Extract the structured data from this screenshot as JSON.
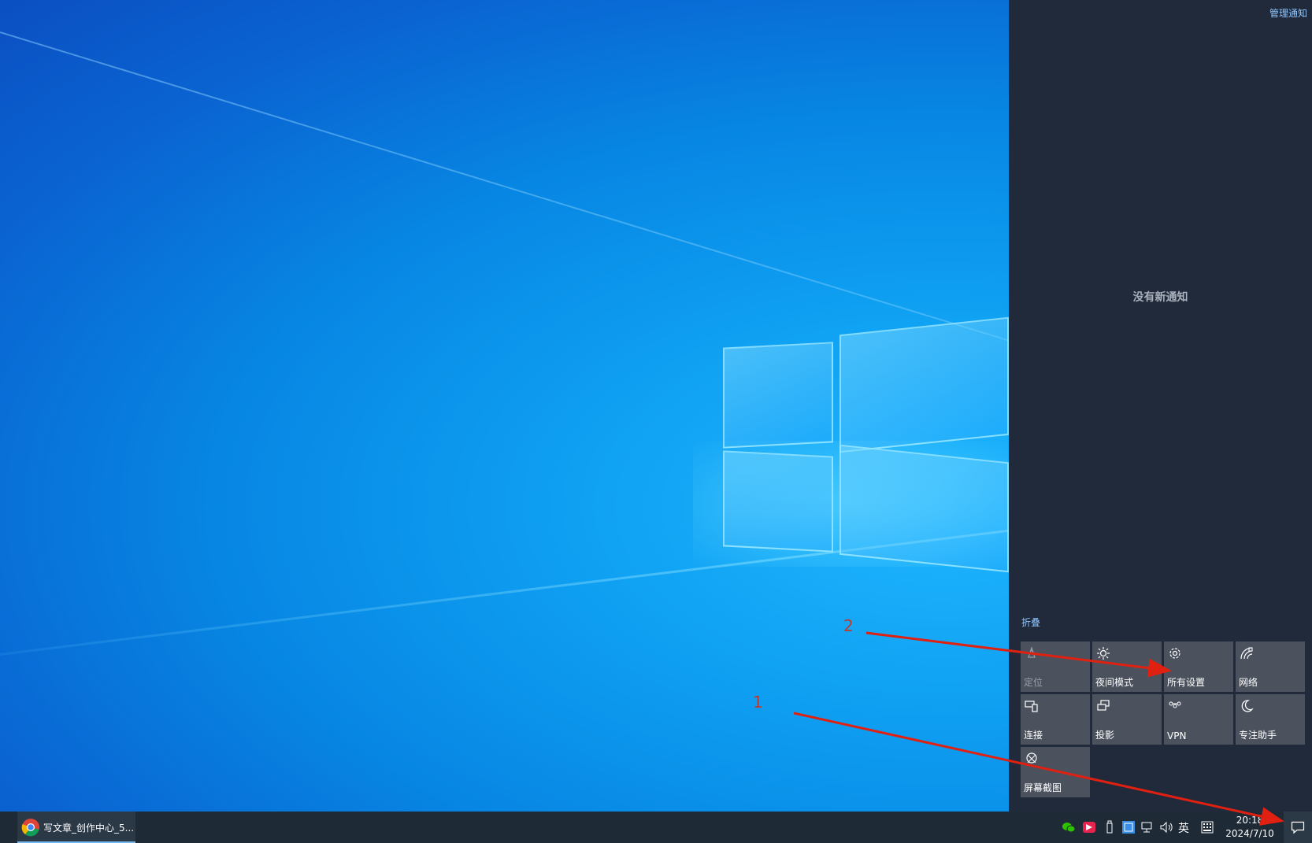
{
  "action_center": {
    "manage_label": "管理通知",
    "empty_message": "没有新通知",
    "collapse_label": "折叠",
    "quick_actions": [
      {
        "label": "定位",
        "icon": "location-icon",
        "enabled": false
      },
      {
        "label": "夜间模式",
        "icon": "night-light-icon",
        "enabled": true
      },
      {
        "label": "所有设置",
        "icon": "gear-icon",
        "enabled": true
      },
      {
        "label": "网络",
        "icon": "network-icon",
        "enabled": true
      },
      {
        "label": "连接",
        "icon": "connect-icon",
        "enabled": true
      },
      {
        "label": "投影",
        "icon": "project-icon",
        "enabled": true
      },
      {
        "label": "VPN",
        "icon": "vpn-icon",
        "enabled": true
      },
      {
        "label": "专注助手",
        "icon": "focus-assist-icon",
        "enabled": true
      },
      {
        "label": "屏幕截图",
        "icon": "screen-snip-icon",
        "enabled": true
      }
    ]
  },
  "taskbar": {
    "app_label": "写文章_创作中心_5...",
    "app_icon": "chrome-icon",
    "tray_icons": [
      "wechat-icon",
      "app-tray-icon",
      "usb-icon",
      "app-tray-icon-2",
      "network-tray-icon",
      "volume-icon"
    ],
    "ime_label": "英",
    "ime_grid_icon": "ime-grid-icon",
    "time": "20:18",
    "date": "2024/7/10",
    "notification_icon": "notification-icon"
  },
  "annotations": {
    "labels": [
      "1",
      "2"
    ],
    "color": "#e02010"
  },
  "colors": {
    "action_center_bg": "#212a3a",
    "tile_bg": "#4b525e",
    "link": "#8fc6ff",
    "taskbar_bg": "#1e2a36"
  }
}
